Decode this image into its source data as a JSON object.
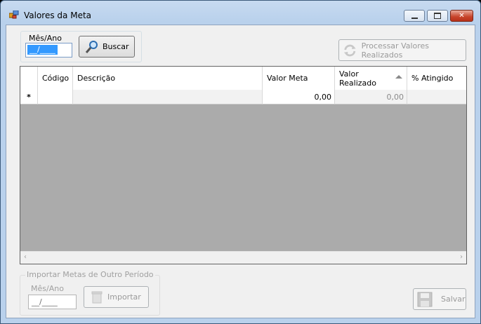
{
  "window": {
    "title": "Valores da Meta"
  },
  "search": {
    "label": "Mês/Ano",
    "value": "__/____",
    "button": "Buscar"
  },
  "process_button": "Processar Valores Realizados",
  "grid": {
    "columns": [
      "Código",
      "Descrição",
      "Valor Meta",
      "Valor\nRealizado",
      "% Atingido"
    ],
    "sort_column": "Valor Realizado",
    "new_row": {
      "marker": "*",
      "valor_meta": "0,00",
      "valor_realizado": "0,00"
    }
  },
  "import_group": {
    "legend": "Importar Metas de Outro Período",
    "label": "Mês/Ano",
    "value": "__/____",
    "button": "Importar"
  },
  "save_button": "Salvar"
}
